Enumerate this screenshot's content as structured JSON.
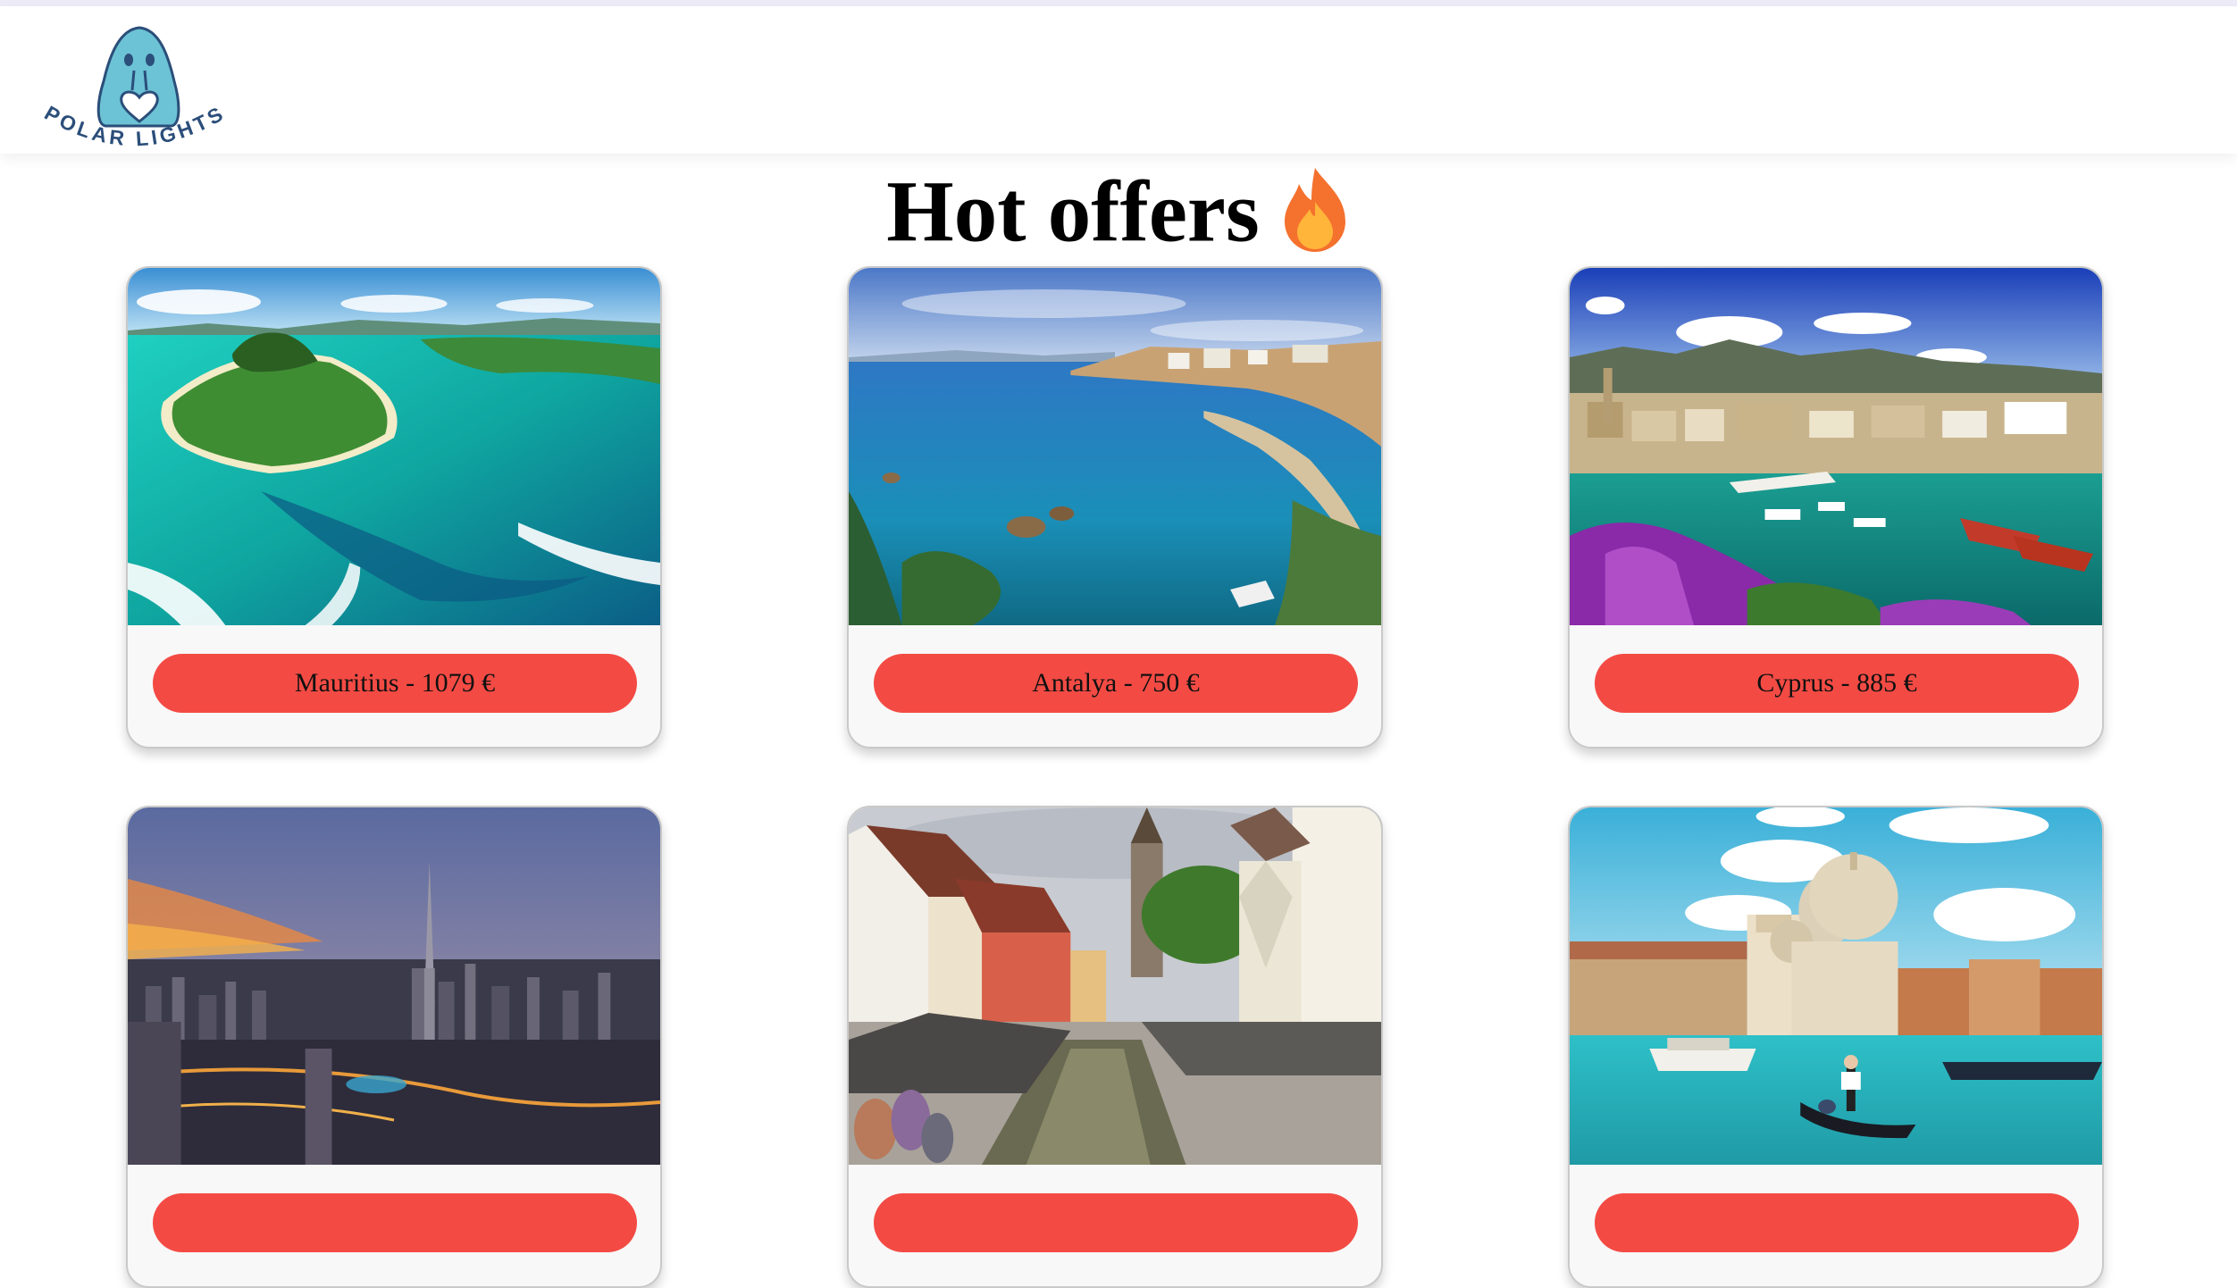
{
  "brand": {
    "name": "POLAR LIGHTS",
    "logo_icon": "walrus-heart-logo",
    "color": "#2b4e7a",
    "icon_color": "#6cc3d5"
  },
  "page": {
    "title": "Hot offers",
    "title_icon": "fire-icon"
  },
  "colors": {
    "button": "#f34b44",
    "card_background": "#f8f8f8",
    "header_rule": "#ecebf7"
  },
  "offers": [
    {
      "label": "Mauritius - 1079 €",
      "image": "mauritius-island-aerial-photo"
    },
    {
      "label": "Antalya - 750 €",
      "image": "antalya-coast-photo"
    },
    {
      "label": "Cyprus - 885 €",
      "image": "cyprus-harbor-photo"
    },
    {
      "label": "",
      "image": "dubai-skyline-photo"
    },
    {
      "label": "",
      "image": "european-canal-town-photo"
    },
    {
      "label": "",
      "image": "venice-gondola-photo"
    }
  ]
}
